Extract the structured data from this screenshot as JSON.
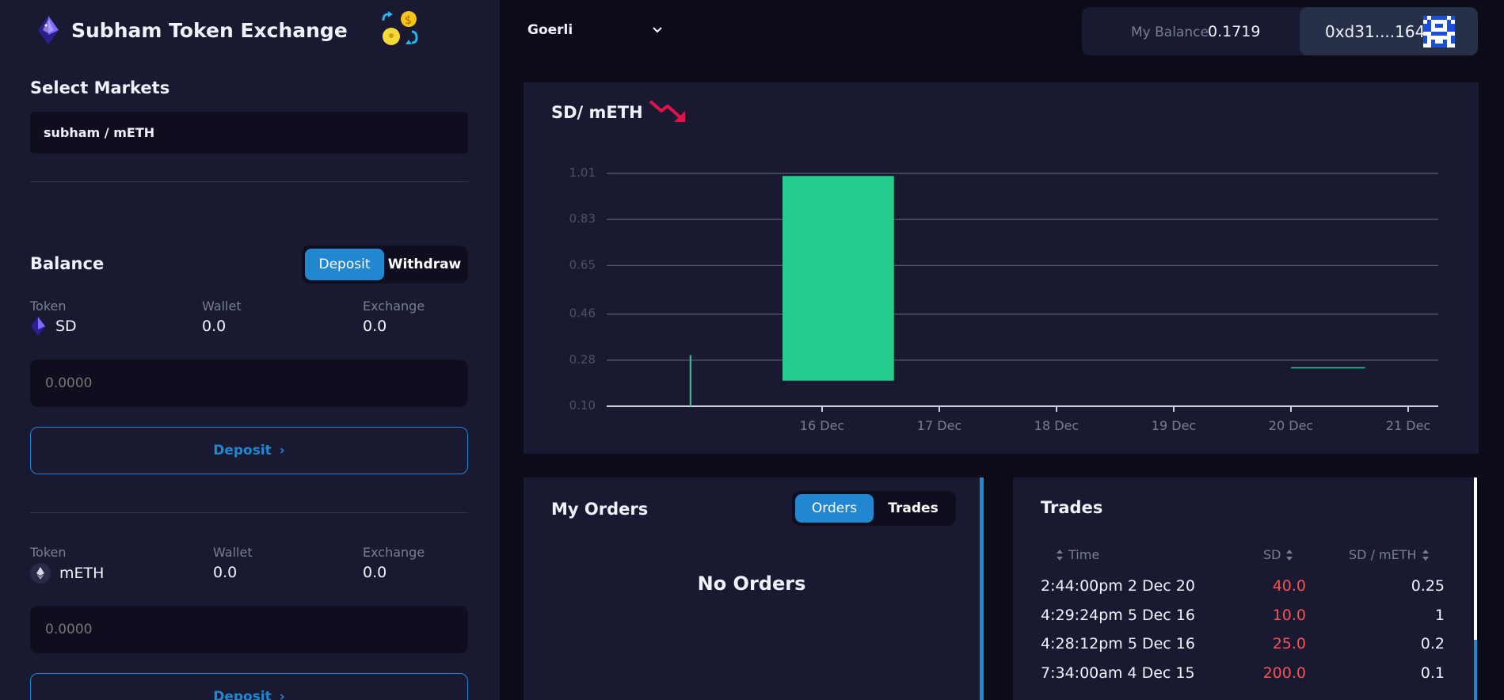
{
  "app": {
    "title": "Subham Token Exchange"
  },
  "markets": {
    "heading": "Select Markets",
    "selected": "subham / mETH"
  },
  "balance": {
    "heading": "Balance",
    "toggle": {
      "deposit": "Deposit",
      "withdraw": "Withdraw"
    },
    "tokens": [
      {
        "token_label": "Token",
        "symbol": "SD",
        "wallet_label": "Wallet",
        "wallet_value": "0.0",
        "exchange_label": "Exchange",
        "exchange_value": "0.0",
        "input_placeholder": "0.0000",
        "button_label": "Deposit",
        "icon": "diamond-token-icon"
      },
      {
        "token_label": "Token",
        "symbol": "mETH",
        "wallet_label": "Wallet",
        "wallet_value": "0.0",
        "exchange_label": "Exchange",
        "exchange_value": "0.0",
        "input_placeholder": "0.0000",
        "button_label": "Deposit",
        "icon": "eth-icon"
      }
    ]
  },
  "topbar": {
    "network": "Goerli",
    "balance_label": "My Balance",
    "balance_value": "0.1719",
    "account": "0xd31....1648"
  },
  "chart": {
    "title": "SD/ mETH",
    "trend": "down",
    "trend_color": "#e0144c"
  },
  "chart_data": {
    "type": "candlestick",
    "x_ticks": [
      "16 Dec",
      "17 Dec",
      "18 Dec",
      "19 Dec",
      "20 Dec",
      "21 Dec"
    ],
    "y_ticks": [
      "1.01",
      "0.83",
      "0.65",
      "0.46",
      "0.28",
      "0.10"
    ],
    "ylim": [
      0.1,
      1.01
    ],
    "grid": true,
    "candles": [
      {
        "date": "15 Dec",
        "open": 0.1,
        "high": 0.3,
        "low": 0.1,
        "close": 0.1
      },
      {
        "date": "16 Dec",
        "open": 0.2,
        "high": 1.0,
        "low": 0.2,
        "close": 1.0
      },
      {
        "date": "20 Dec",
        "open": 0.25,
        "high": 0.25,
        "low": 0.25,
        "close": 0.25
      }
    ],
    "up_color": "#25ce8f"
  },
  "orders": {
    "heading": "My Orders",
    "toggle": {
      "orders": "Orders",
      "trades": "Trades"
    },
    "empty_text": "No Orders"
  },
  "trades": {
    "heading": "Trades",
    "columns": [
      "Time",
      "SD",
      "SD / mETH"
    ],
    "rows": [
      {
        "time": "2:44:00pm 2 Dec 20",
        "amount": "40.0",
        "price": "0.25"
      },
      {
        "time": "4:29:24pm 5 Dec 16",
        "amount": "10.0",
        "price": "1"
      },
      {
        "time": "4:28:12pm 5 Dec 16",
        "amount": "25.0",
        "price": "0.2"
      },
      {
        "time": "7:34:00am 4 Dec 15",
        "amount": "200.0",
        "price": "0.1"
      }
    ]
  },
  "colors": {
    "accent": "#2187d0",
    "sell": "#f45353",
    "buy": "#25ce8f"
  }
}
